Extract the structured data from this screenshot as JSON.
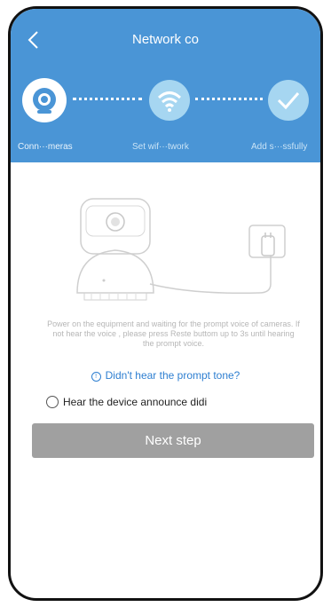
{
  "header": {
    "title": "Network co",
    "steps": [
      {
        "label": "Conn···meras",
        "icon": "camera-icon"
      },
      {
        "label": "Set wif···twork",
        "icon": "wifi-icon"
      },
      {
        "label": "Add s···ssfully",
        "icon": "check-icon"
      }
    ]
  },
  "instructions": "Power on the equipment and waiting for the prompt voice of cameras. If not hear the voice , please press Reste buttom up to 3s until hearing the prompt voice.",
  "help_link": "Didn't hear the prompt tone?",
  "radio": {
    "label": "Hear the device announce didi",
    "checked": false
  },
  "next_button": "Next step",
  "colors": {
    "header": "#4a95d6",
    "link": "#2e7fd1",
    "button": "#a0a0a0"
  }
}
